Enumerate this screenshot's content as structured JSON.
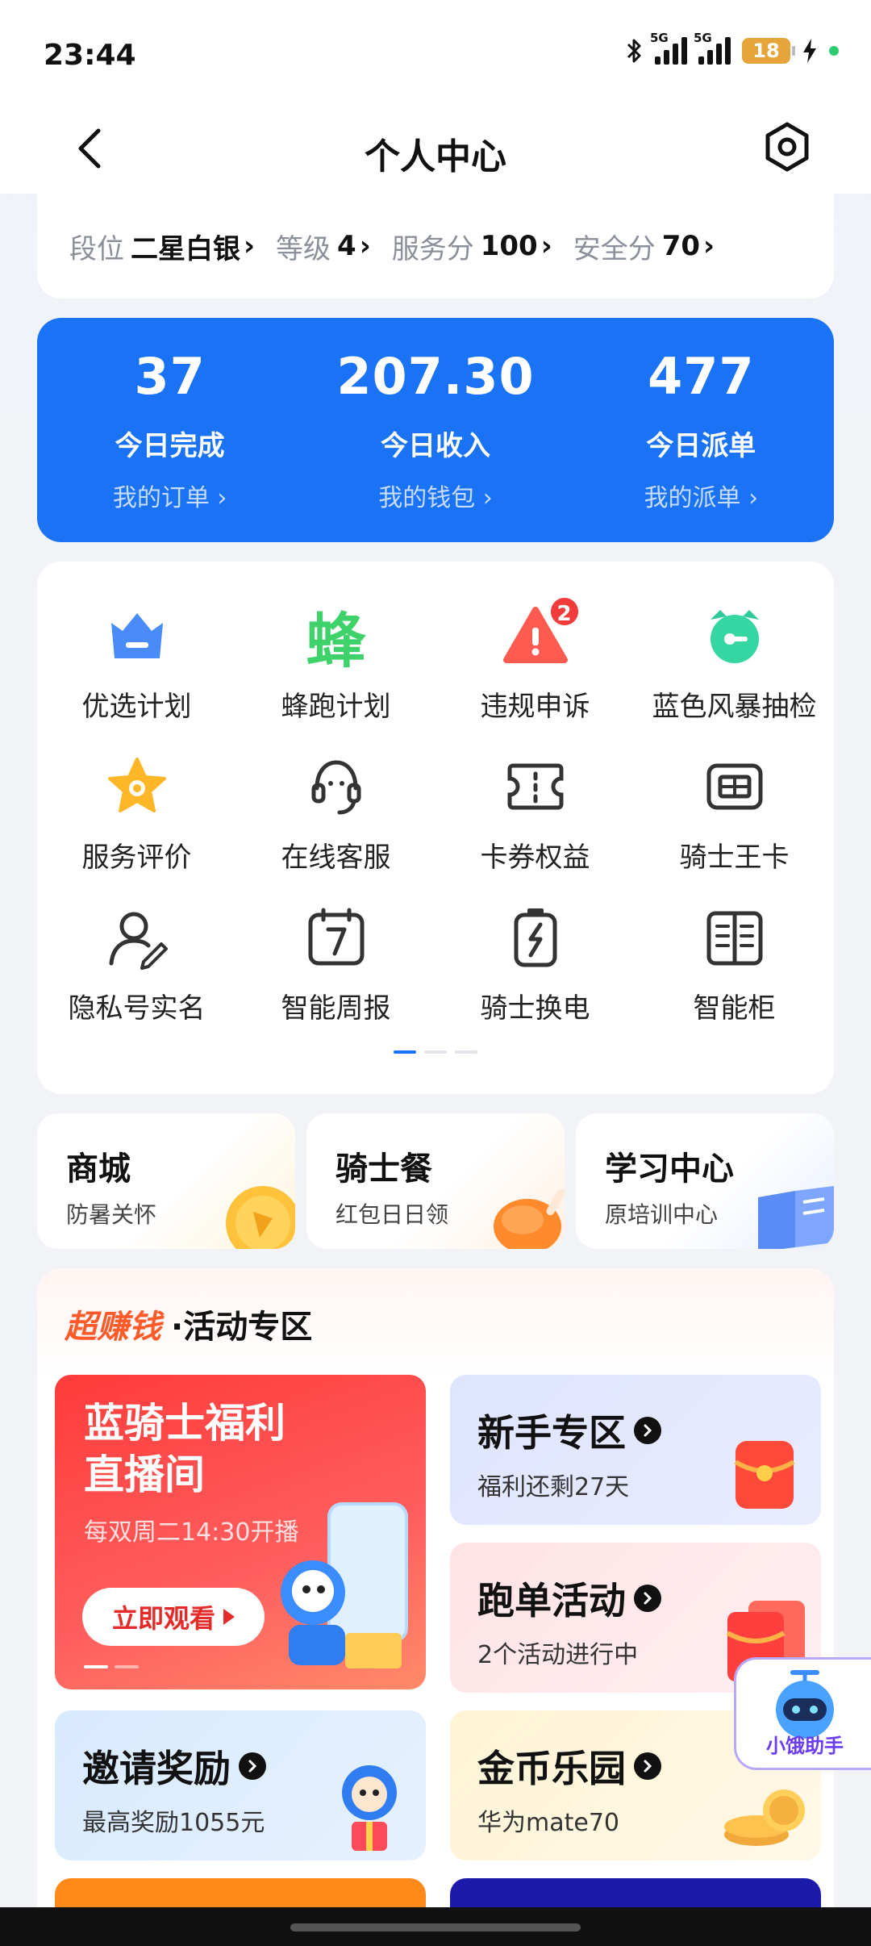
{
  "status": {
    "time": "23:44",
    "battery": "18",
    "net1": "5G",
    "net2": "5G"
  },
  "header": {
    "title": "个人中心"
  },
  "rank": [
    {
      "label": "段位",
      "value": "二星白银"
    },
    {
      "label": "等级",
      "value": "4"
    },
    {
      "label": "服务分",
      "value": "100"
    },
    {
      "label": "安全分",
      "value": "70"
    }
  ],
  "stats": [
    {
      "value": "37",
      "label": "今日完成",
      "link": "我的订单 ›"
    },
    {
      "value": "207.30",
      "label": "今日收入",
      "link": "我的钱包 ›"
    },
    {
      "value": "477",
      "label": "今日派单",
      "link": "我的派单 ›"
    }
  ],
  "grid": [
    {
      "label": "优选计划",
      "icon": "crown-icon"
    },
    {
      "label": "蜂跑计划",
      "icon": "feng-icon",
      "glyph": "蜂"
    },
    {
      "label": "违规申诉",
      "icon": "warning-icon",
      "badge": "2"
    },
    {
      "label": "蓝色风暴抽检",
      "icon": "alarm-icon"
    },
    {
      "label": "服务评价",
      "icon": "star-icon"
    },
    {
      "label": "在线客服",
      "icon": "headset-icon"
    },
    {
      "label": "卡券权益",
      "icon": "coupon-icon"
    },
    {
      "label": "骑士王卡",
      "icon": "card-icon"
    },
    {
      "label": "隐私号实名",
      "icon": "user-pen-icon"
    },
    {
      "label": "智能周报",
      "icon": "calendar-icon",
      "glyph": "7"
    },
    {
      "label": "骑士换电",
      "icon": "battery-swap-icon"
    },
    {
      "label": "智能柜",
      "icon": "locker-icon"
    }
  ],
  "shortcuts": [
    {
      "title": "商城",
      "sub": "防暑关怀"
    },
    {
      "title": "骑士餐",
      "sub": "红包日日领"
    },
    {
      "title": "学习中心",
      "sub": "原培训中心"
    }
  ],
  "activity": {
    "hot": "超赚钱",
    "title": "·活动专区",
    "live": {
      "line1": "蓝骑士福利",
      "line2": "直播间",
      "sub": "每双周二14:30开播",
      "button": "立即观看"
    },
    "tiles": [
      {
        "title": "新手专区",
        "sub": "福利还剩27天"
      },
      {
        "title": "跑单活动",
        "sub": "2个活动进行中"
      },
      {
        "title": "邀请奖励",
        "sub": "最高奖励1055元"
      },
      {
        "title": "金币乐园",
        "sub": "华为mate70"
      }
    ]
  },
  "helper": {
    "label": "小饿助手"
  },
  "colors": {
    "primary": "#1a72f5",
    "red": "#ff3b3b",
    "text": "#111111"
  }
}
